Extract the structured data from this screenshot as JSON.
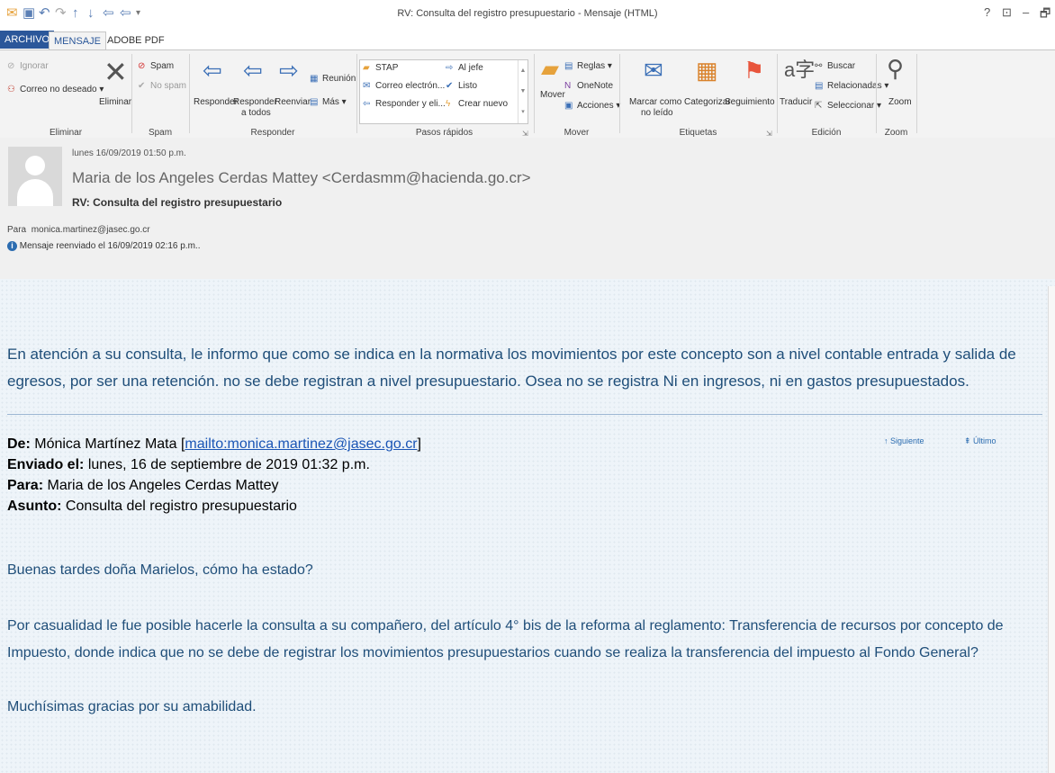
{
  "window": {
    "title": "RV: Consulta del registro presupuestario - Mensaje (HTML)",
    "help": "?",
    "restore_ribbon": "⊡",
    "minimize": "–",
    "maximize": "🗗"
  },
  "tabs": [
    "ARCHIVO",
    "MENSAJE",
    "ADOBE PDF"
  ],
  "ribbon": {
    "eliminar_group": {
      "ignorar": "Ignorar",
      "correo_no_deseado": "Correo no deseado",
      "eliminar": "Eliminar",
      "label": "Eliminar"
    },
    "spam_group": {
      "spam": "Spam",
      "no_spam": "No spam",
      "label": "Spam"
    },
    "responder_group": {
      "responder": "Responder",
      "responder_todos_1": "Responder",
      "responder_todos_2": "a todos",
      "reenviar": "Reenviar",
      "reunion": "Reunión",
      "mas": "Más",
      "label": "Responder"
    },
    "pasos_group": {
      "stap": "STAP",
      "al_jefe": "Al jefe",
      "correo_electron": "Correo electrón...",
      "listo": "Listo",
      "responder_eli": "Responder y eli...",
      "crear_nuevo": "Crear nuevo",
      "label": "Pasos rápidos"
    },
    "mover_group": {
      "mover": "Mover",
      "reglas": "Reglas",
      "onenote": "OneNote",
      "acciones": "Acciones",
      "label": "Mover"
    },
    "etiquetas_group": {
      "marcar_1": "Marcar como",
      "marcar_2": "no leído",
      "categorizar": "Categorizar",
      "seguimiento": "Seguimiento",
      "label": "Etiquetas"
    },
    "edicion_group": {
      "traducir": "Traducir",
      "buscar": "Buscar",
      "relacionadas": "Relacionadas",
      "seleccionar": "Seleccionar",
      "label": "Edición"
    },
    "zoom_group": {
      "zoom": "Zoom",
      "label": "Zoom"
    }
  },
  "header": {
    "date": "lunes 16/09/2019 01:50 p.m.",
    "sender": "Maria de los Angeles Cerdas Mattey <Cerdasmm@hacienda.go.cr>",
    "subject": "RV: Consulta del registro presupuestario",
    "to_label": "Para",
    "to": "monica.martinez@jasec.go.cr",
    "info": "Mensaje reenviado el 16/09/2019 02:16 p.m.."
  },
  "body": {
    "reply_line1": "En atención a su consulta, le informo que como se indica en la normativa los movimientos por este concepto son a nivel contable entrada y salida de",
    "reply_line2": "egresos, por ser una retención. no se debe registran a nivel presupuestario. Osea  no se registra  Ni en ingresos, ni en  gastos presupuestados.",
    "nav_next": "Siguiente",
    "nav_last": "Último",
    "de_label": "De:",
    "de_value": "Mónica Martínez Mata [",
    "de_link": "mailto:monica.martinez@jasec.go.cr",
    "de_close": "]",
    "enviado_label": "Enviado el:",
    "enviado_value": "lunes, 16 de septiembre de 2019 01:32 p.m.",
    "para_label": "Para:",
    "para_value": "Maria de los Angeles Cerdas Mattey",
    "asunto_label": "Asunto:",
    "asunto_value": "Consulta del registro presupuestario",
    "greeting": "Buenas tardes doña Marielos, cómo ha estado?",
    "para2_line1": "Por casualidad le fue posible hacerle la consulta a su compañero, del artículo 4° bis de la reforma al reglamento: Transferencia de recursos por concepto de",
    "para2_line2": "Impuesto, donde indica que no se debe de registrar los movimientos presupuestarios cuando se realiza la transferencia del impuesto al Fondo General?",
    "thanks": "Muchísimas gracias por su amabilidad."
  }
}
